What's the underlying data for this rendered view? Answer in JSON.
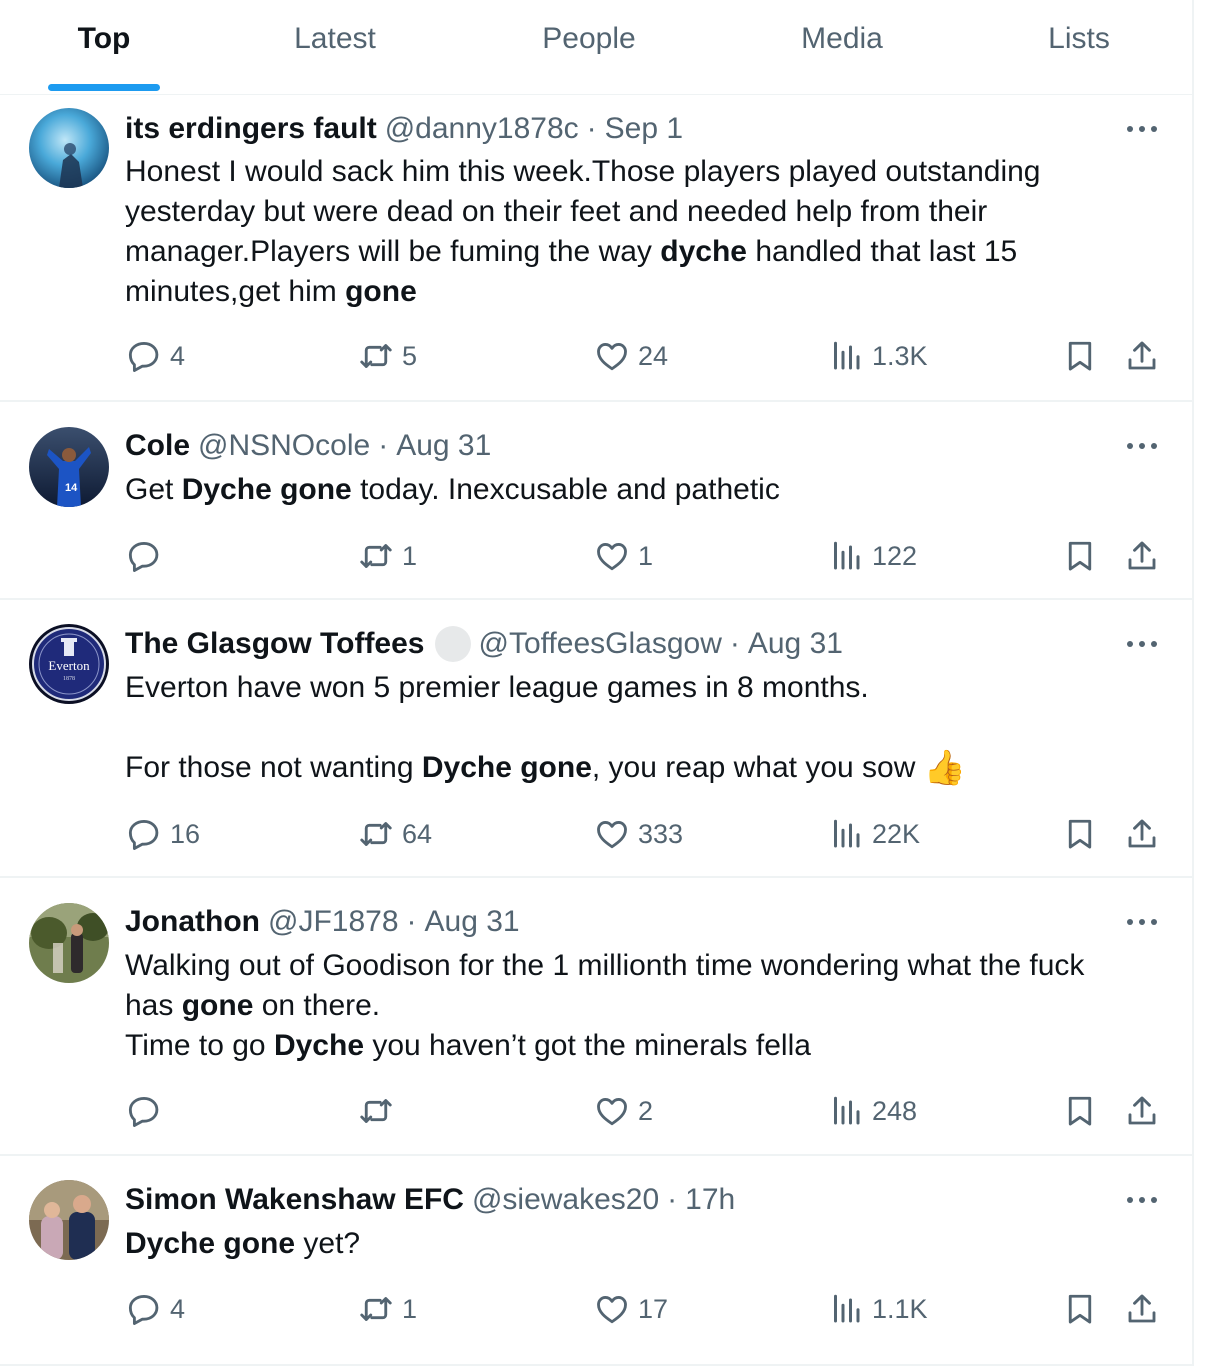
{
  "tabs": [
    "Top",
    "Latest",
    "People",
    "Media",
    "Lists"
  ],
  "active_tab": "Top",
  "tweets": [
    {
      "name": "its erdingers fault",
      "handle": "@danny1878c",
      "sep": "·",
      "time": "Sep 1",
      "text": [
        [
          {
            "t": "Honest I would sack him this week.Those players played outstanding",
            "b": false
          }
        ],
        [
          {
            "t": "yesterday but were dead on their feet and needed help from their",
            "b": false
          }
        ],
        [
          {
            "t": "manager.Players will be fuming the way ",
            "b": false
          },
          {
            "t": "dyche",
            "b": true
          },
          {
            "t": " handled that last 15",
            "b": false
          }
        ],
        [
          {
            "t": "minutes,get him ",
            "b": false
          },
          {
            "t": "gone",
            "b": true
          }
        ]
      ],
      "replies": "4",
      "retweets": "5",
      "likes": "24",
      "views": "1.3K"
    },
    {
      "name": "Cole",
      "handle": "@NSNOcole",
      "sep": "·",
      "time": "Aug 31",
      "text": [
        [
          {
            "t": "Get ",
            "b": false
          },
          {
            "t": "Dyche gone",
            "b": true
          },
          {
            "t": " today. Inexcusable and pathetic",
            "b": false
          }
        ]
      ],
      "replies": "",
      "retweets": "1",
      "likes": "1",
      "views": "122"
    },
    {
      "name": "The Glasgow Toffees",
      "verified_badge": true,
      "handle": "@ToffeesGlasgow",
      "sep": "·",
      "time": "Aug 31",
      "text": [
        [
          {
            "t": "Everton have won 5 premier league games in 8 months.",
            "b": false
          }
        ],
        [],
        [
          {
            "t": "For those not wanting ",
            "b": false
          },
          {
            "t": "Dyche gone",
            "b": true
          },
          {
            "t": ", you reap what you sow ",
            "b": false
          },
          {
            "t": "👍",
            "b": false,
            "emoji": true
          }
        ]
      ],
      "avatar_text": "Everton",
      "avatar_year": "1878",
      "replies": "16",
      "retweets": "64",
      "likes": "333",
      "views": "22K"
    },
    {
      "name": "Jonathon",
      "handle": "@JF1878",
      "sep": "·",
      "time": "Aug 31",
      "text": [
        [
          {
            "t": "Walking out of Goodison for the 1 millionth time wondering what the fuck",
            "b": false
          }
        ],
        [
          {
            "t": "has ",
            "b": false
          },
          {
            "t": "gone",
            "b": true
          },
          {
            "t": " on there.",
            "b": false
          }
        ],
        [
          {
            "t": "Time to go ",
            "b": false
          },
          {
            "t": "Dyche",
            "b": true
          },
          {
            "t": " you haven’t got the minerals fella",
            "b": false
          }
        ]
      ],
      "replies": "",
      "retweets": "",
      "likes": "2",
      "views": "248"
    },
    {
      "name": "Simon Wakenshaw EFC",
      "handle": "@siewakes20",
      "sep": "·",
      "time": "17h",
      "text": [
        [
          {
            "t": "Dyche gone",
            "b": true
          },
          {
            "t": " yet?",
            "b": false
          }
        ]
      ],
      "replies": "4",
      "retweets": "1",
      "likes": "17",
      "views": "1.1K"
    }
  ],
  "icons": {
    "reply": "reply-icon",
    "retweet": "retweet-icon",
    "like": "heart-icon",
    "views": "views-chart-icon",
    "bookmark": "bookmark-icon",
    "share": "share-icon",
    "more": "more-dots-icon"
  },
  "colors": {
    "accent": "#1d9bf0",
    "text": "#0f1419",
    "secondary": "#536471",
    "divider": "#eff3f4"
  }
}
